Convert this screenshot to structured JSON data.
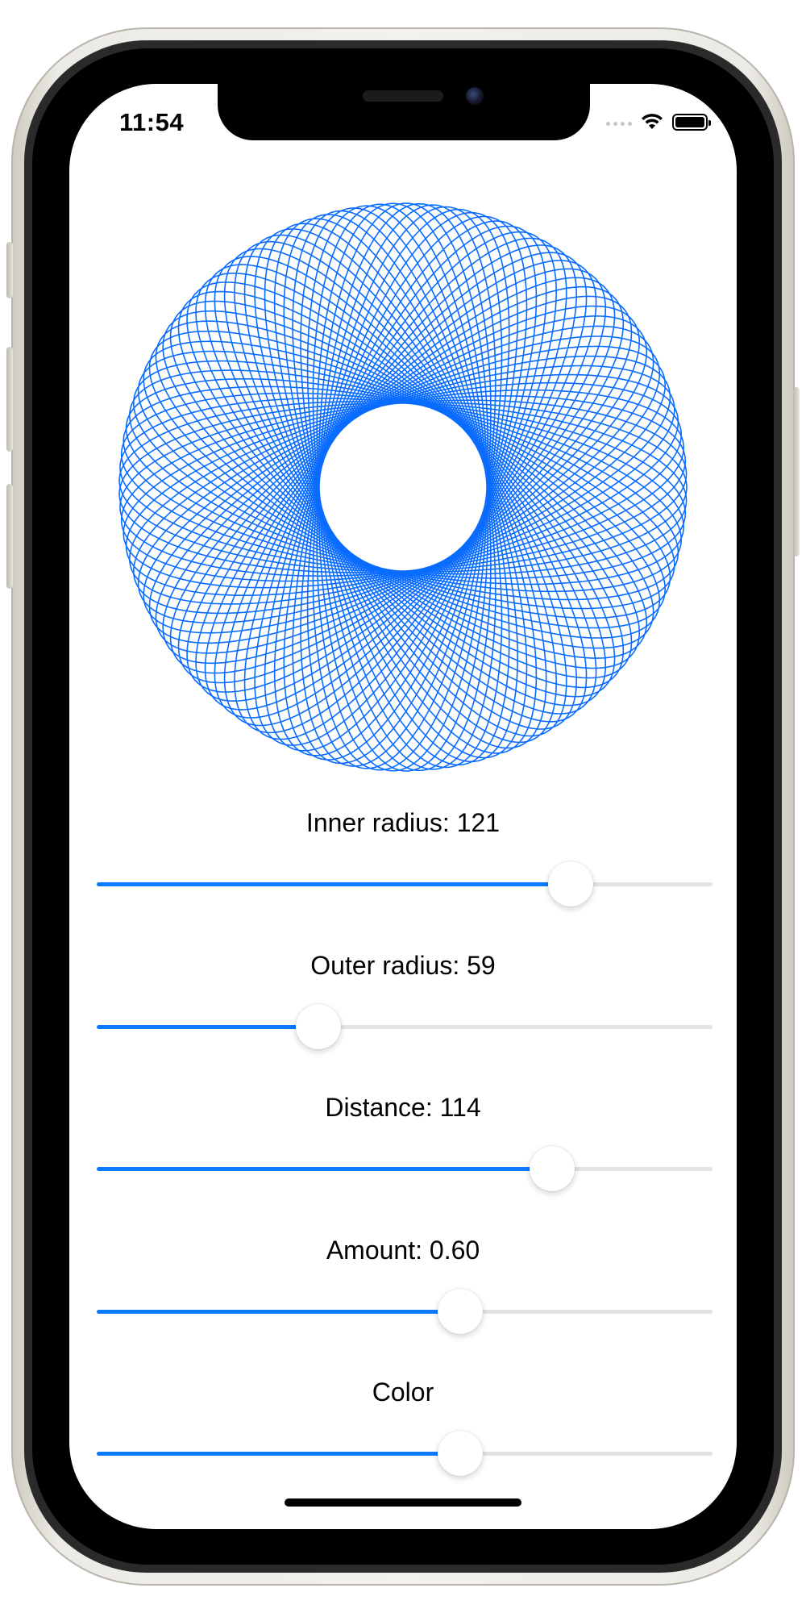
{
  "status_bar": {
    "time": "11:54"
  },
  "spirograph": {
    "stroke_color": "#0a6cff"
  },
  "controls": [
    {
      "label": "Inner radius: 121",
      "value": 0.77
    },
    {
      "label": "Outer radius: 59",
      "value": 0.36
    },
    {
      "label": "Distance: 114",
      "value": 0.74
    },
    {
      "label": "Amount: 0.60",
      "value": 0.59
    },
    {
      "label": "Color",
      "value": 0.59
    }
  ],
  "colors": {
    "slider_fill": "#0a7aff",
    "slider_track": "#e3e3e6"
  }
}
